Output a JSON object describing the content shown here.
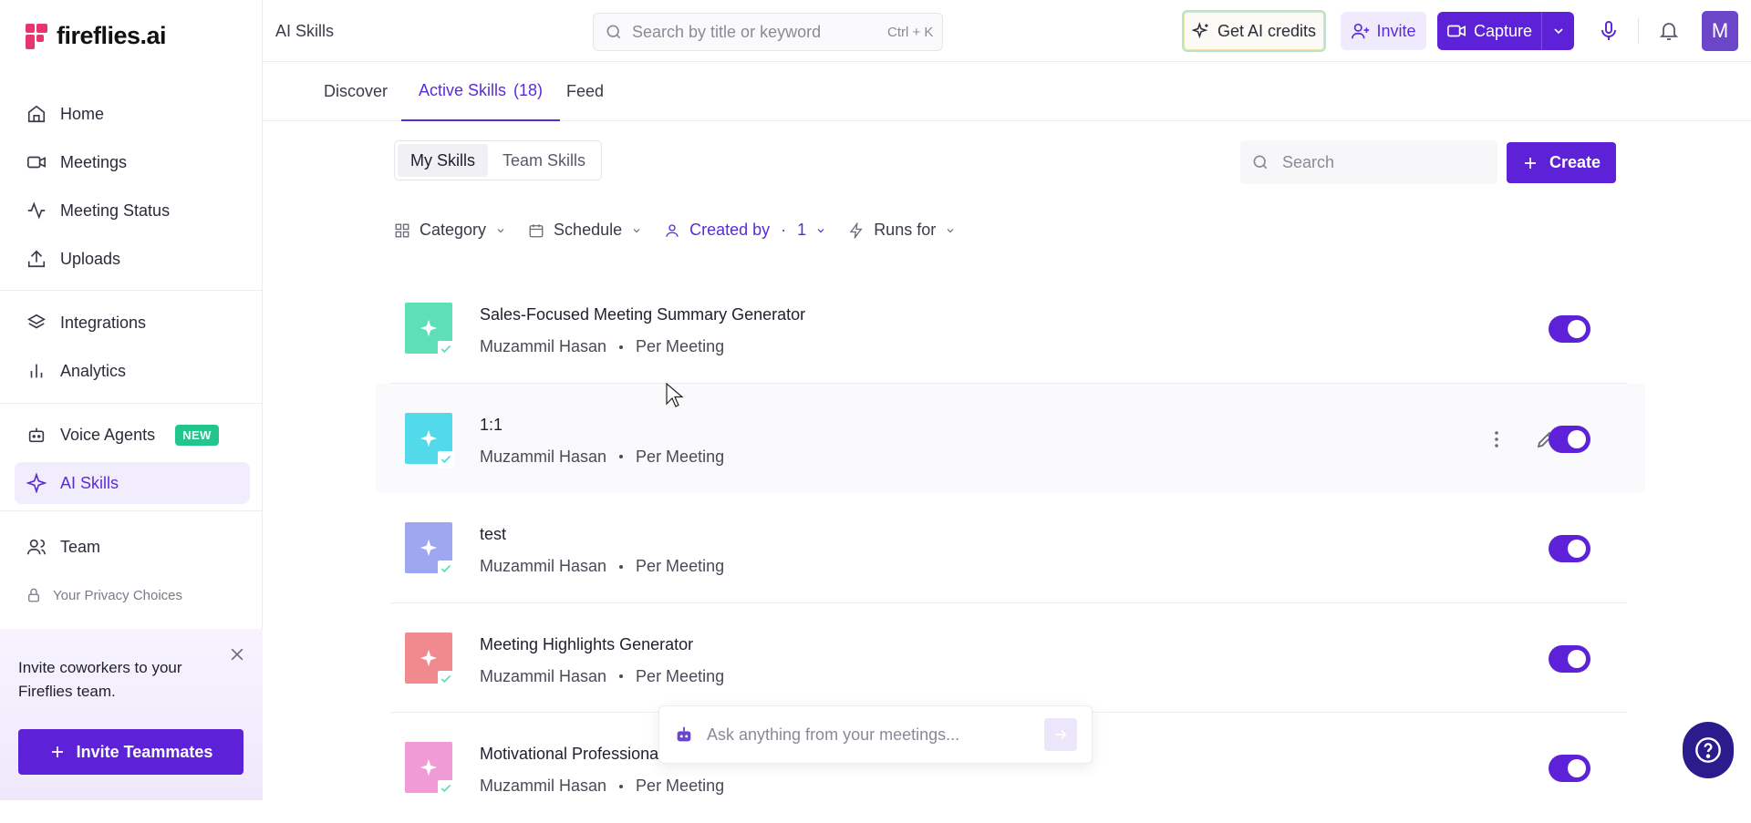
{
  "brand": {
    "name": "fireflies.ai",
    "color": "#e8356d",
    "accent": "#5d22d8"
  },
  "sidebar": {
    "items": [
      {
        "label": "Home",
        "icon": "home-icon"
      },
      {
        "label": "Meetings",
        "icon": "video-icon"
      },
      {
        "label": "Meeting Status",
        "icon": "activity-icon"
      },
      {
        "label": "Uploads",
        "icon": "upload-icon"
      },
      {
        "label": "Integrations",
        "icon": "layers-icon"
      },
      {
        "label": "Analytics",
        "icon": "bar-chart-icon"
      },
      {
        "label": "Voice Agents",
        "icon": "robot-icon",
        "badge": "NEW"
      },
      {
        "label": "AI Skills",
        "icon": "sparkle-icon",
        "active": true
      },
      {
        "label": "Team",
        "icon": "users-icon"
      }
    ],
    "privacy": "Your Privacy Choices",
    "invite_card": {
      "message": "Invite coworkers to your Fireflies team.",
      "button": "Invite Teammates"
    }
  },
  "topbar": {
    "title": "AI Skills",
    "search_placeholder": "Search by title or keyword",
    "shortcut": "Ctrl + K",
    "credits": "Get AI credits",
    "invite": "Invite",
    "capture": "Capture",
    "avatar": "M"
  },
  "tabs": [
    {
      "label": "Discover"
    },
    {
      "label": "Active Skills",
      "count": "(18)",
      "active": true
    },
    {
      "label": "Feed"
    }
  ],
  "segment": {
    "options": [
      "My Skills",
      "Team Skills"
    ],
    "selected": "My Skills"
  },
  "content_search_placeholder": "Search",
  "create": "Create",
  "filters": {
    "category": "Category",
    "schedule": "Schedule",
    "created_by": "Created by",
    "created_by_count": "1",
    "runs_for": "Runs for"
  },
  "skills": [
    {
      "name": "Sales-Focused Meeting Summary Generator",
      "author": "Muzammil Hasan",
      "frequency": "Per Meeting",
      "color": "#5de0b8",
      "enabled": true
    },
    {
      "name": "1:1",
      "author": "Muzammil Hasan",
      "frequency": "Per Meeting",
      "color": "#52d9ea",
      "enabled": true
    },
    {
      "name": "test",
      "author": "Muzammil Hasan",
      "frequency": "Per Meeting",
      "color": "#9da8f0",
      "enabled": true
    },
    {
      "name": "Meeting Highlights Generator",
      "author": "Muzammil Hasan",
      "frequency": "Per Meeting",
      "color": "#f08a8f",
      "enabled": true
    },
    {
      "name": "Motivational Professional Fe",
      "author": "Muzammil Hasan",
      "frequency": "Per Meeting",
      "color": "#f09ad6",
      "enabled": true
    }
  ],
  "ask_placeholder": "Ask anything from your meetings..."
}
